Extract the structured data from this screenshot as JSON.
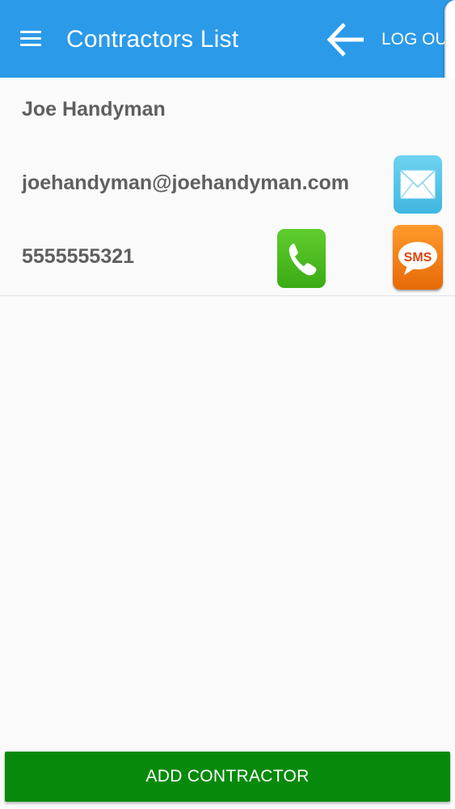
{
  "appbar": {
    "title": "Contractors List",
    "menu_icon": "hamburger-menu-icon",
    "back_icon": "arrow-left-icon",
    "logout_label": "LOG OUT",
    "background_color": "#2b9ae9"
  },
  "contractors": [
    {
      "name": "Joe Handyman",
      "email": "joehandyman@joehandyman.com",
      "phone": "5555555321",
      "email_icon": "envelope-icon",
      "call_icon": "phone-icon",
      "sms_icon": "sms-icon",
      "sms_label": "SMS"
    }
  ],
  "footer": {
    "add_label": "ADD CONTRACTOR",
    "button_color": "#078a0b"
  }
}
